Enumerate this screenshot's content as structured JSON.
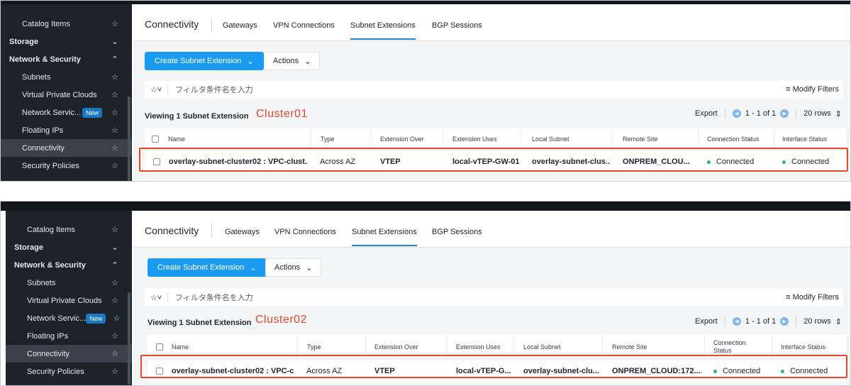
{
  "panels": [
    {
      "cluster_label": "Cluster01",
      "sidebar": [
        {
          "label": "Catalog Items",
          "type": "sub",
          "icon": "star-icon"
        },
        {
          "label": "Storage",
          "type": "group",
          "icon": "chevron-down-icon"
        },
        {
          "label": "Network & Security",
          "type": "group",
          "icon": "chevron-up-icon"
        },
        {
          "label": "Subnets",
          "type": "sub",
          "icon": "star-icon"
        },
        {
          "label": "Virtual Private Clouds",
          "type": "sub",
          "icon": "star-icon"
        },
        {
          "label": "Network Servic...",
          "type": "sub",
          "icon": "star-icon",
          "badge": "New"
        },
        {
          "label": "Floating IPs",
          "type": "sub",
          "icon": "star-icon"
        },
        {
          "label": "Connectivity",
          "type": "sub",
          "icon": "star-icon",
          "active": true
        },
        {
          "label": "Security Policies",
          "type": "sub",
          "icon": "star-icon"
        }
      ],
      "tabs": {
        "title": "Connectivity",
        "items": [
          "Gateways",
          "VPN Connections",
          "Subnet Extensions",
          "BGP Sessions"
        ],
        "active": "Subnet Extensions"
      },
      "toolbar": {
        "create_label": "Create Subnet Extension",
        "actions_label": "Actions"
      },
      "filter": {
        "placeholder": "フィルタ条件名を入力",
        "modify_label": "Modify Filters"
      },
      "viewing": "Viewing 1 Subnet Extension",
      "pager": {
        "export": "Export",
        "range": "1 - 1 of 1",
        "rows": "20 rows"
      },
      "table": {
        "columns": [
          "Name",
          "Type",
          "Extension Over",
          "Extension Uses",
          "Local Subnet",
          "Remote Site",
          "Connection Status",
          "Interface Status"
        ],
        "row": [
          "overlay-subnet-cluster02 : VPC-clust...",
          "Across AZ",
          "VTEP",
          "local-vTEP-GW-01",
          "overlay-subnet-clus...",
          "ONPREM_CLOU...",
          "Connected",
          "Connected"
        ]
      }
    },
    {
      "cluster_label": "Cluster02",
      "sidebar": [
        {
          "label": "Catalog Items",
          "type": "sub",
          "icon": "star-icon"
        },
        {
          "label": "Storage",
          "type": "group",
          "icon": "chevron-down-icon"
        },
        {
          "label": "Network & Security",
          "type": "group",
          "icon": "chevron-up-icon"
        },
        {
          "label": "Subnets",
          "type": "sub",
          "icon": "star-icon"
        },
        {
          "label": "Virtual Private Clouds",
          "type": "sub",
          "icon": "star-icon"
        },
        {
          "label": "Network Servic...",
          "type": "sub",
          "icon": "star-icon",
          "badge": "New"
        },
        {
          "label": "Floating IPs",
          "type": "sub",
          "icon": "star-icon"
        },
        {
          "label": "Connectivity",
          "type": "sub",
          "icon": "star-icon",
          "active": true
        },
        {
          "label": "Security Policies",
          "type": "sub",
          "icon": "star-icon"
        }
      ],
      "tabs": {
        "title": "Connectivity",
        "items": [
          "Gateways",
          "VPN Connections",
          "Subnet Extensions",
          "BGP Sessions"
        ],
        "active": "Subnet Extensions"
      },
      "toolbar": {
        "create_label": "Create Subnet Extension",
        "actions_label": "Actions"
      },
      "filter": {
        "placeholder": "フィルタ条件名を入力",
        "modify_label": "Modify Filters"
      },
      "viewing": "Viewing 1 Subnet Extension",
      "pager": {
        "export": "Export",
        "range": "1 - 1 of 1",
        "rows": "20 rows"
      },
      "table": {
        "columns": [
          "Name",
          "Type",
          "Extension Over",
          "Extension Uses",
          "Local Subnet",
          "Remote Site",
          "Connection Status",
          "Interface Status"
        ],
        "row": [
          "overlay-subnet-cluster02 : VPC-c...",
          "Across AZ",
          "VTEP",
          "local-vTEP-G...",
          "overlay-subnet-clu...",
          "ONPREM_CLOUD:172....",
          "Connected",
          "Connected"
        ]
      }
    }
  ],
  "colors": {
    "accent": "#1b9bf0",
    "highlight": "#e8462a",
    "status_ok": "#2bb673",
    "sidebar_bg": "#1d2329"
  }
}
